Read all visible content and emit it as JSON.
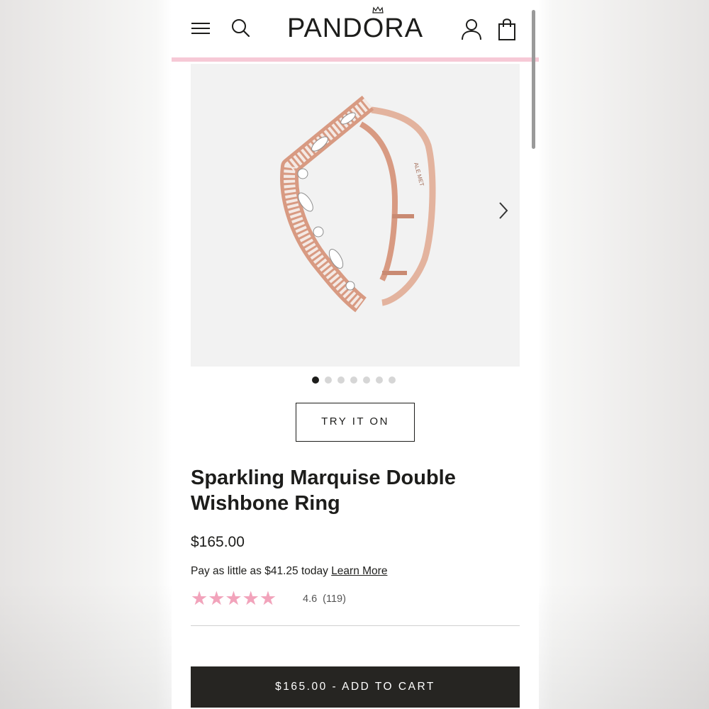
{
  "header": {
    "brand": "PANDORA",
    "icons": [
      "menu-icon",
      "search-icon",
      "account-icon",
      "shopping-bag-icon",
      "crown-icon"
    ]
  },
  "gallery": {
    "image_count": 7,
    "active_index": 0,
    "engraving": "ALE MET"
  },
  "actions": {
    "try_on_label": "TRY IT ON",
    "add_to_cart_label": "$165.00 - ADD TO CART"
  },
  "product": {
    "title": "Sparkling Marquise Double Wishbone Ring",
    "price": "$165.00",
    "pay_text": "Pay as little as $41.25 today",
    "learn_more": "Learn More",
    "rating_value": "4.6",
    "rating_count": "(119)",
    "rating_fraction": 0.92
  },
  "colors": {
    "accent_pink": "#f6c9d6",
    "star_pink": "#f2a3bb",
    "text_dark": "#1d1d1b",
    "cart_button": "#262522",
    "rose_gold": "#d89a82"
  }
}
